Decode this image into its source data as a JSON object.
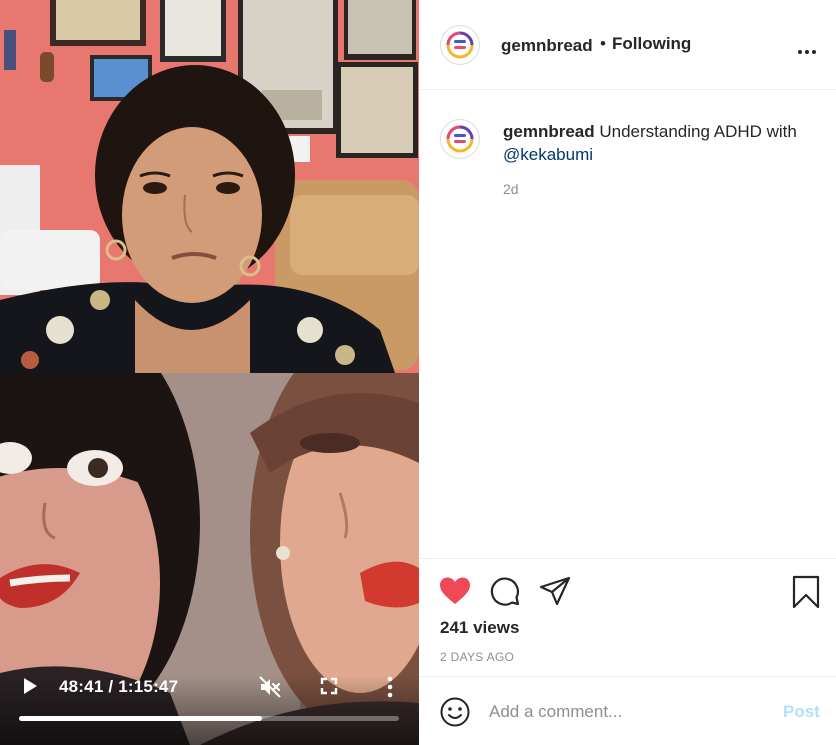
{
  "video": {
    "time": "48:41 / 1:15:47",
    "progress_fraction": 0.64
  },
  "header": {
    "username": "gemnbread",
    "separator": "•",
    "follow_status": "Following"
  },
  "caption": {
    "username": "gemnbread",
    "text_before": "Understanding ADHD with ",
    "mention": "@kekabumi",
    "time_ago": "2d"
  },
  "stats": {
    "views": "241 views",
    "date": "2 DAYS AGO"
  },
  "comment": {
    "placeholder": "Add a comment...",
    "post_label": "Post"
  },
  "colors": {
    "like_red": "#ed4956",
    "mention_blue": "#00376b",
    "post_disabled": "#b2dffc",
    "wall_pink": "#ea7b72"
  },
  "icons": [
    "play-icon",
    "mute-icon",
    "fullscreen-icon",
    "more-vertical-icon",
    "more-horizontal-icon",
    "heart-icon",
    "comment-icon",
    "share-icon",
    "bookmark-icon",
    "emoji-icon"
  ]
}
